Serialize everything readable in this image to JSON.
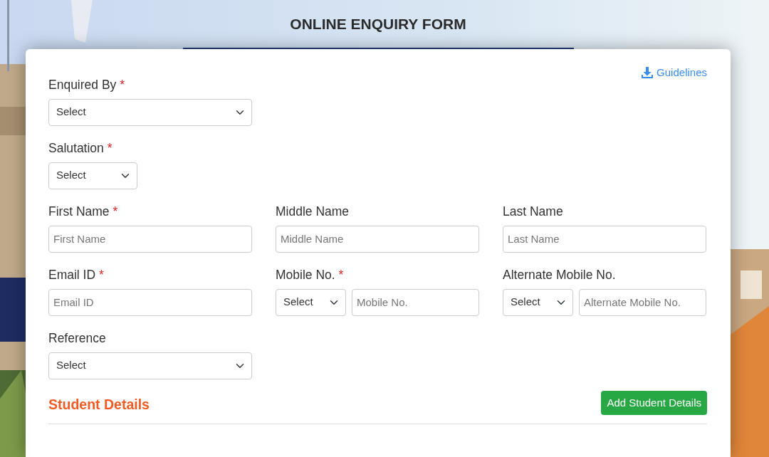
{
  "header": {
    "title": "ONLINE ENQUIRY FORM"
  },
  "guidelines_link": {
    "label": "Guidelines"
  },
  "rows": [
    [
      {
        "label": "Enquired By",
        "required_mark": "*",
        "controls": [
          {
            "kind": "select",
            "value": "Select"
          }
        ]
      }
    ],
    [
      {
        "label": "Salutation",
        "required_mark": "*",
        "controls": [
          {
            "kind": "short-select",
            "value": "Select"
          }
        ]
      }
    ],
    [
      {
        "label": "First Name",
        "required_mark": "*",
        "controls": [
          {
            "kind": "input",
            "placeholder": "First Name"
          }
        ]
      },
      {
        "label": "Middle Name",
        "controls": [
          {
            "kind": "input",
            "placeholder": "Middle Name"
          }
        ]
      },
      {
        "label": "Last Name",
        "controls": [
          {
            "kind": "input",
            "placeholder": "Last Name"
          }
        ]
      }
    ],
    [
      {
        "label": "Email ID",
        "required_mark": "*",
        "controls": [
          {
            "kind": "input",
            "placeholder": "Email ID"
          }
        ]
      },
      {
        "label": "Mobile No.",
        "required_mark": "*",
        "controls": [
          {
            "kind": "code-select",
            "value": "Select"
          },
          {
            "kind": "input",
            "placeholder": "Mobile No."
          }
        ]
      },
      {
        "label": "Alternate Mobile No.",
        "controls": [
          {
            "kind": "code-select",
            "value": "Select"
          },
          {
            "kind": "input",
            "placeholder": "Alternate Mobile No."
          }
        ]
      }
    ],
    [
      {
        "label": "Reference",
        "controls": [
          {
            "kind": "select",
            "value": "Select"
          }
        ]
      }
    ]
  ],
  "section": {
    "title": "Student Details",
    "button": "Add Student Details"
  }
}
